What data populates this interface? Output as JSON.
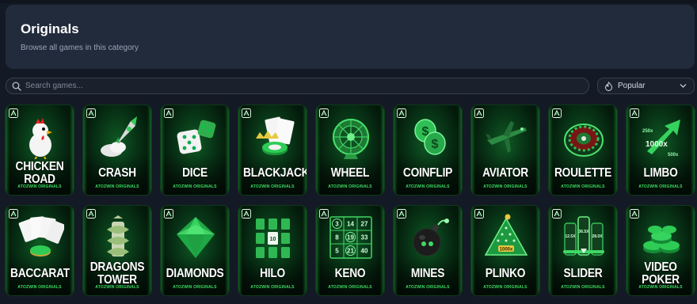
{
  "header": {
    "title": "Originals",
    "subtitle": "Browse all games in this category"
  },
  "search": {
    "placeholder": "Search games...",
    "icon": "search-icon"
  },
  "sort": {
    "selected": "Popular",
    "icon": "fire-icon"
  },
  "colors": {
    "page_bg": "#141a25",
    "header_bg": "#222b3c",
    "card_green": "#0f5a24",
    "accent_green": "#3ddc61"
  },
  "games": [
    {
      "title": "CHICKEN ROAD",
      "lines": [
        "CHICKEN",
        "ROAD"
      ],
      "subtitle": "ATOZWIN ORIGINALS",
      "icon": "chicken-icon"
    },
    {
      "title": "CRASH",
      "lines": [
        "CRASH"
      ],
      "subtitle": "ATOZWIN ORIGINALS",
      "icon": "rocket-icon"
    },
    {
      "title": "DICE",
      "lines": [
        "DICE"
      ],
      "subtitle": "ATOZWIN ORIGINALS",
      "icon": "dice-icon"
    },
    {
      "title": "BLACKJACK",
      "lines": [
        "BLACKJACK"
      ],
      "subtitle": "ATOZWIN ORIGINALS",
      "icon": "cards-crown-icon"
    },
    {
      "title": "WHEEL",
      "lines": [
        "WHEEL"
      ],
      "subtitle": "ATOZWIN ORIGINALS",
      "icon": "wheel-icon"
    },
    {
      "title": "COINFLIP",
      "lines": [
        "COINFLIP"
      ],
      "subtitle": "ATOZWIN ORIGINALS",
      "icon": "coins-icon"
    },
    {
      "title": "AVIATOR",
      "lines": [
        "AVIATOR"
      ],
      "subtitle": "ATOZWIN ORIGINALS",
      "icon": "plane-icon"
    },
    {
      "title": "ROULETTE",
      "lines": [
        "ROULETTE"
      ],
      "subtitle": "ATOZWIN ORIGINALS",
      "icon": "roulette-icon"
    },
    {
      "title": "LIMBO",
      "lines": [
        "LIMBO"
      ],
      "subtitle": "ATOZWIN ORIGINALS",
      "icon": "arrow-up-icon",
      "art_text": [
        "250x",
        "1000x",
        "500x"
      ]
    },
    {
      "title": "BACCARAT",
      "lines": [
        "BACCARAT"
      ],
      "subtitle": "ATOZWIN ORIGINALS",
      "icon": "aces-icon"
    },
    {
      "title": "DRAGONS TOWER",
      "lines": [
        "DRAGONS",
        "TOWER"
      ],
      "subtitle": "ATOZWIN ORIGINALS",
      "icon": "dragon-tower-icon"
    },
    {
      "title": "DIAMONDS",
      "lines": [
        "DIAMONDS"
      ],
      "subtitle": "ATOZWIN ORIGINALS",
      "icon": "diamond-icon"
    },
    {
      "title": "HILO",
      "lines": [
        "HILO"
      ],
      "subtitle": "ATOZWIN ORIGINALS",
      "icon": "card-grid-icon",
      "art_text": [
        "10"
      ]
    },
    {
      "title": "KENO",
      "lines": [
        "KENO"
      ],
      "subtitle": "ATOZWIN ORIGINALS",
      "icon": "keno-board-icon",
      "art_text": [
        "3",
        "14",
        "27",
        "8",
        "19",
        "33",
        "5",
        "21",
        "40"
      ]
    },
    {
      "title": "MINES",
      "lines": [
        "MINES"
      ],
      "subtitle": "ATOZWIN ORIGINALS",
      "icon": "bomb-icon"
    },
    {
      "title": "PLINKO",
      "lines": [
        "PLINKO"
      ],
      "subtitle": "ATOZWIN ORIGINALS",
      "icon": "plinko-icon",
      "art_text": [
        "1000x"
      ]
    },
    {
      "title": "SLIDER",
      "lines": [
        "SLIDER"
      ],
      "subtitle": "ATOZWIN ORIGINALS",
      "icon": "slider-icon",
      "art_text": [
        "36.5X",
        "28.0X",
        "12.5X"
      ]
    },
    {
      "title": "VIDEO POKER",
      "lines": [
        "VIDEO",
        "POKER"
      ],
      "subtitle": "ATOZWIN ORIGINALS",
      "icon": "chips-icon"
    }
  ]
}
